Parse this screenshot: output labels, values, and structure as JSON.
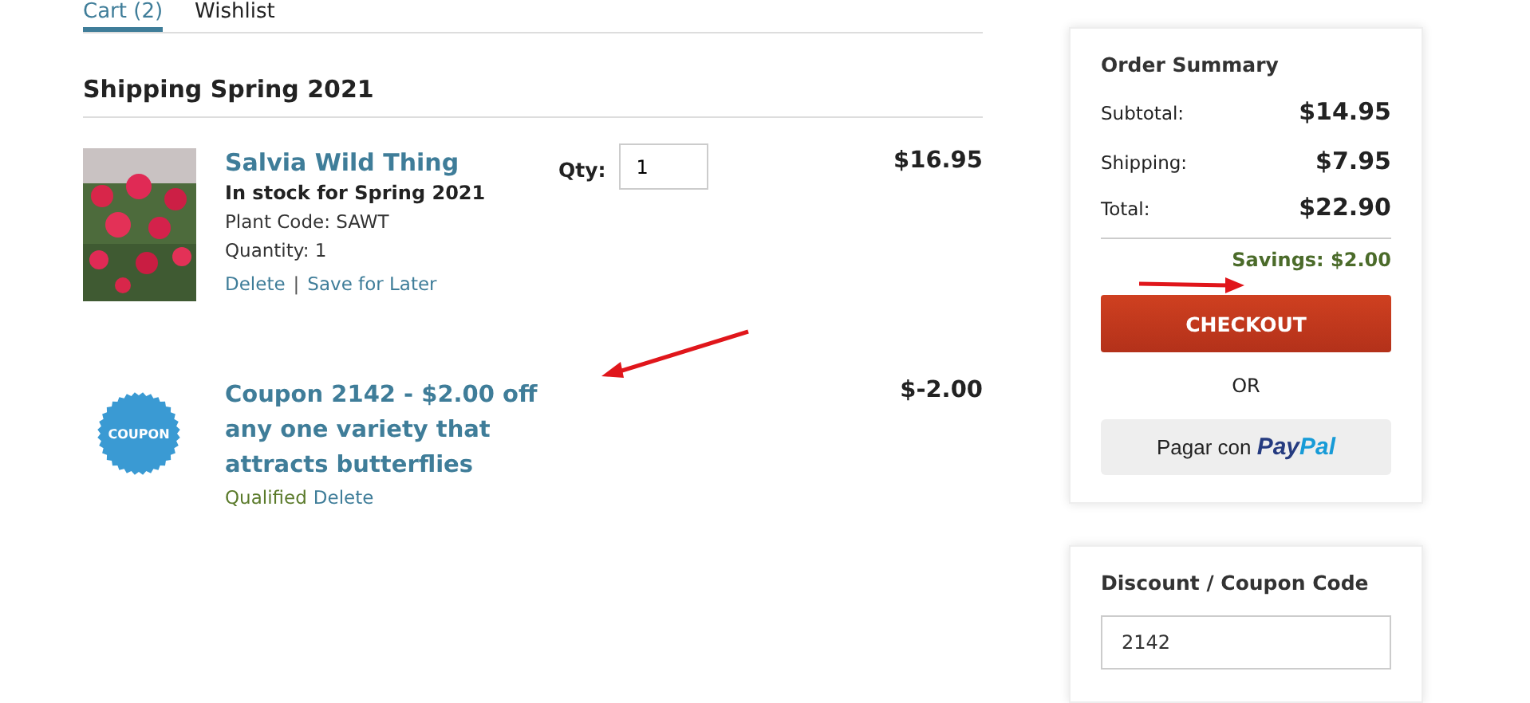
{
  "tabs": [
    {
      "label": "Cart (2)",
      "selected": true
    },
    {
      "label": "Wishlist",
      "selected": false
    }
  ],
  "section_title": "Shipping Spring 2021",
  "items": [
    {
      "kind": "plant",
      "name": "Salvia Wild Thing",
      "stock": "In stock for Spring 2021",
      "plant_code": "Plant Code: SAWT",
      "quantity": "Quantity: 1",
      "qty_label": "Qty:",
      "qty_value": "1",
      "price": "$16.95",
      "links": [
        "Delete",
        "Save for Later"
      ],
      "separator": "|"
    },
    {
      "kind": "coupon",
      "badge": "COUPON",
      "name": "Coupon 2142 - $2.00 off any one variety that attracts butterflies",
      "status": "Qualified",
      "links": [
        "Delete"
      ],
      "price": "$-2.00"
    }
  ],
  "order_summary": {
    "title": "Order Summary",
    "rows": [
      {
        "label": "Subtotal:",
        "value": "$14.95"
      },
      {
        "label": "Shipping:",
        "value": "$7.95"
      },
      {
        "label": "Total:",
        "value": "$22.90"
      }
    ],
    "savings": "Savings: $2.00",
    "checkout": "CHECKOUT",
    "or": "OR",
    "paypal": {
      "label": "Pagar con",
      "logo": [
        "Pay",
        "Pal"
      ]
    }
  },
  "discount": {
    "title": "Discount / Coupon Code",
    "value": "2142"
  }
}
